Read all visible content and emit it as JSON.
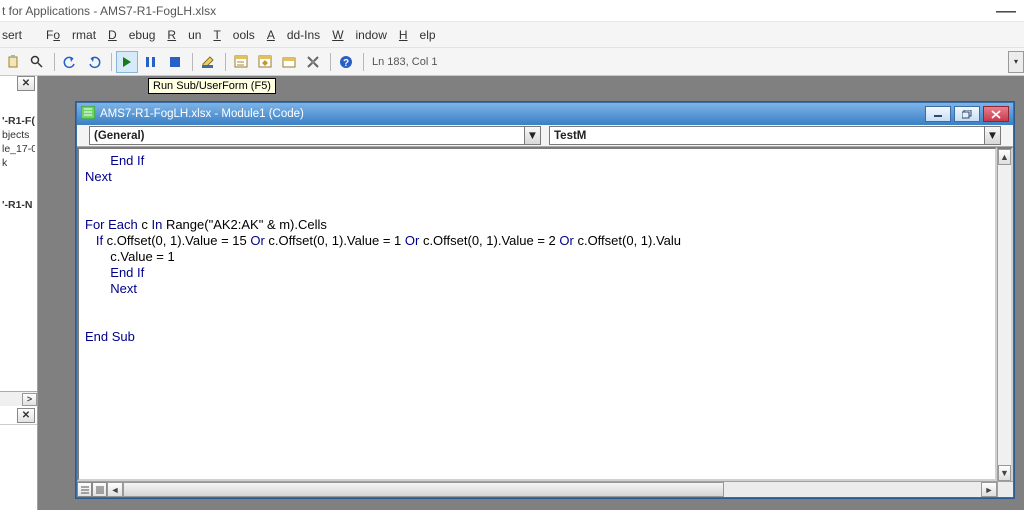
{
  "app_title_fragment": "t for Applications - AMS7-R1-FogLH.xlsx",
  "menus": {
    "insert": "sert",
    "format": "Format",
    "debug": "Debug",
    "run": "Run",
    "tools": "Tools",
    "addins": "Add-Ins",
    "window": "Window",
    "help": "Help"
  },
  "toolbar": {
    "tooltip_run": "Run Sub/UserForm (F5)",
    "status": "Ln 183, Col 1"
  },
  "project_panel": {
    "items": [
      "'-R1-F(",
      "bjects",
      "le_17-0",
      "k",
      "",
      "'-R1-N"
    ]
  },
  "code_window": {
    "title": "AMS7-R1-FogLH.xlsx - Module1 (Code)",
    "object_dropdown": "(General)",
    "proc_dropdown": "TestM"
  },
  "code": {
    "l1a": "       End If",
    "l2": "Next",
    "l3": "",
    "l4": "",
    "l5a": "For Each",
    "l5b": " c ",
    "l5c": "In",
    "l5d": " Range(\"AK2:AK\" & m).Cells",
    "l6a": "   If",
    "l6b": " c.Offset(0, 1).Value = 15 ",
    "l6c": "Or",
    "l6d": " c.Offset(0, 1).Value = 1 ",
    "l6e": "Or",
    "l6f": " c.Offset(0, 1).Value = 2 ",
    "l6g": "Or",
    "l6h": " c.Offset(0, 1).Valu",
    "l7": "       c.Value = 1",
    "l8a": "       End If",
    "l9a": "       Next",
    "l10": "",
    "l11": "",
    "l12": "End Sub"
  }
}
